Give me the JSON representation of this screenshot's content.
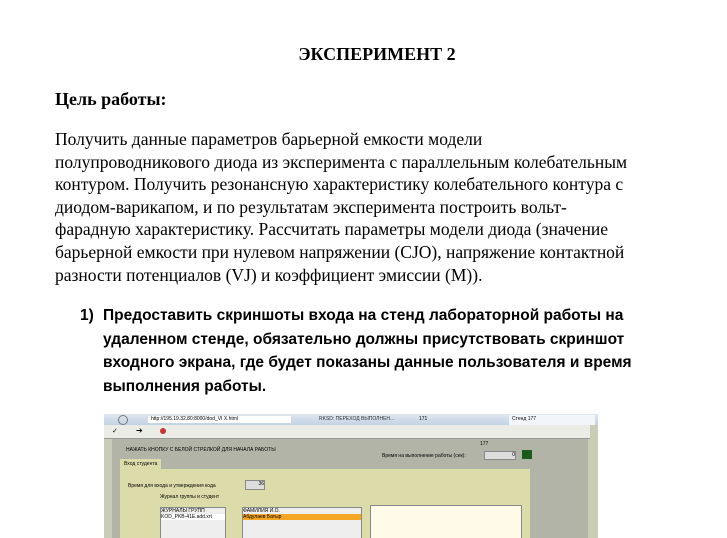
{
  "title": "ЭКСПЕРИМЕНТ 2",
  "goal_heading": "Цель работы:",
  "paragraph_lines": [
    "Получить данные параметров барьерной емкости модели",
    "полупроводникового диода из эксперимента с параллельным колебательным",
    "контуром. Получить резонансную характеристику колебательного контура с",
    "диодом-варикапом, и по результатам эксперимента построить вольт-",
    "фарадную характеристику. Рассчитать параметры модели диода (значение",
    "барьерной емкости при нулевом напряжении (CJO), напряжение контактной",
    "разности потенциалов (VJ) и коэффициент эмиссии (M))."
  ],
  "list": [
    {
      "number": "1)",
      "lines": [
        "Предоставить скриншоты входа на стенд лабораторной работы на",
        "удаленном стенде, обязательно должны присутствовать скриншот",
        "входного экрана, где будет показаны данные пользователя и время",
        "выполнения работы."
      ]
    }
  ],
  "screenshot": {
    "url": "http://195.19.32.80:8000/dod_VI X.html",
    "tab1": "RKSD: ПЕРЕХОД ВЫПОЛНЕН...",
    "tab2": "171",
    "tab3": "Стенд 177",
    "instruction": "НАЖАТЬ КНОПКУ С БЕЛОЙ СТРЕЛКОЙ ДЛЯ НАЧАЛА РАБОТЫ",
    "stand_num": "177",
    "time_label": "Время на выполнение работы (сек):",
    "time_value": "0",
    "tab_student": "Вход студента",
    "code_time_label": "Время для входа и утверждения кода",
    "code_time_value": "36",
    "subtab": "Журнал группы и студент",
    "journals_header": "ЖУРНАЛЫ ГРУПП",
    "journal_item": "KOD_PKB-41E.add.xrt",
    "names_header": "ФАМИЛИЯ И.О.",
    "name_item": "Абдулаев Батыр"
  }
}
